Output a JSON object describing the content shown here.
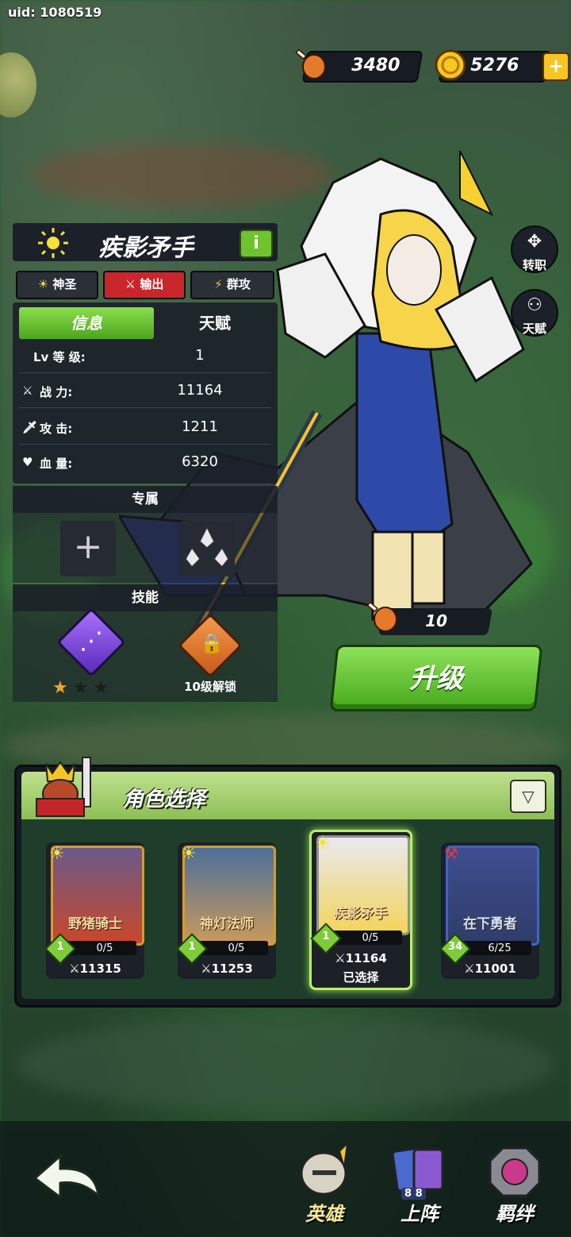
{
  "uid": "uid: 1080519",
  "resources": {
    "food": "3480",
    "gold": "5276",
    "add_icon": "plus-icon"
  },
  "hero": {
    "element_icon": "sun-icon",
    "name": "疾影矛手",
    "info_button": "i",
    "tags": [
      {
        "label": "神圣",
        "icon": "sun-icon"
      },
      {
        "label": "输出",
        "icon": "sword-icon"
      },
      {
        "label": "群攻",
        "icon": "multi-attack-icon"
      }
    ],
    "tabs": {
      "active": "信息",
      "inactive": "天赋"
    },
    "stats": [
      {
        "label": "Lv 等 级:",
        "value": "1",
        "icon": ""
      },
      {
        "label": "战 力:",
        "value": "11164",
        "icon": "crossed-swords-icon"
      },
      {
        "label": "攻 击:",
        "value": "1211",
        "icon": "sword-icon"
      },
      {
        "label": "血 量:",
        "value": "6320",
        "icon": "heart-icon"
      }
    ],
    "exclusive_header": "专属",
    "exclusive_slot_plus": "+",
    "skills_header": "技能",
    "skill_stars": 1,
    "skill_stars_max": 3,
    "locked_skill_text": "10级解锁",
    "side_buttons": [
      "转职",
      "天赋"
    ],
    "upgrade_cost": "10",
    "upgrade_label": "升级"
  },
  "selection": {
    "title": "角色选择",
    "filter_icon": "filter-icon",
    "cards": [
      {
        "name": "野猪骑士",
        "level": "1",
        "progress": "0/5",
        "power": "11315",
        "selected": false,
        "element": "sun-icon"
      },
      {
        "name": "神灯法师",
        "level": "1",
        "progress": "0/5",
        "power": "11253",
        "selected": false,
        "element": "sun-icon"
      },
      {
        "name": "疾影矛手",
        "level": "1",
        "progress": "0/5",
        "power": "11164",
        "selected": true,
        "selected_label": "已选择",
        "element": "sun-icon"
      },
      {
        "name": "在下勇者",
        "level": "34",
        "progress": "6/25",
        "power": "11001",
        "selected": false,
        "element": "dumbbell-icon"
      }
    ]
  },
  "bottom_nav": {
    "back_icon": "back-arrow-icon",
    "items": [
      {
        "label": "英雄",
        "active": true,
        "icon": "helmet-icon"
      },
      {
        "label": "上阵",
        "active": false,
        "icon": "cards-icon",
        "badge": "8 8"
      },
      {
        "label": "羁绊",
        "active": false,
        "icon": "bond-icon"
      }
    ]
  }
}
